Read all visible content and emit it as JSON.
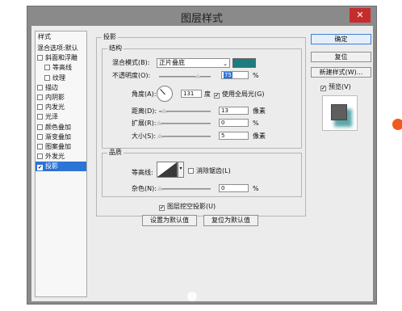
{
  "window": {
    "title": "图层样式",
    "close_glyph": "✕"
  },
  "sidebar": {
    "header": "样式",
    "items": [
      {
        "label": "混合选项:默认",
        "checkbox": false,
        "sub": false
      },
      {
        "label": "斜面和浮雕",
        "checkbox": true,
        "checked": false,
        "sub": false
      },
      {
        "label": "等高线",
        "checkbox": true,
        "checked": false,
        "sub": true
      },
      {
        "label": "纹理",
        "checkbox": true,
        "checked": false,
        "sub": true
      },
      {
        "label": "描边",
        "checkbox": true,
        "checked": false,
        "sub": false
      },
      {
        "label": "内阴影",
        "checkbox": true,
        "checked": false,
        "sub": false
      },
      {
        "label": "内发光",
        "checkbox": true,
        "checked": false,
        "sub": false
      },
      {
        "label": "光泽",
        "checkbox": true,
        "checked": false,
        "sub": false
      },
      {
        "label": "颜色叠加",
        "checkbox": true,
        "checked": false,
        "sub": false
      },
      {
        "label": "渐变叠加",
        "checkbox": true,
        "checked": false,
        "sub": false
      },
      {
        "label": "图案叠加",
        "checkbox": true,
        "checked": false,
        "sub": false
      },
      {
        "label": "外发光",
        "checkbox": true,
        "checked": false,
        "sub": false
      },
      {
        "label": "投影",
        "checkbox": true,
        "checked": true,
        "sub": false,
        "selected": true
      }
    ]
  },
  "drop_shadow": {
    "section_title": "投影",
    "structure": {
      "title": "结构",
      "blend_mode_label": "混合模式(B):",
      "blend_mode_value": "正片叠底",
      "shadow_color": "#1e7c7f",
      "opacity_label": "不透明度(O):",
      "opacity_value": "75",
      "opacity_unit": "%",
      "opacity_fraction": 0.75,
      "angle_label": "角度(A):",
      "angle_value": "131",
      "angle_unit": "度",
      "global_light_label": "使用全局光(G)",
      "global_light_checked": true,
      "distance_label": "距离(D):",
      "distance_value": "13",
      "distance_unit": "像素",
      "spread_label": "扩展(R):",
      "spread_value": "0",
      "spread_unit": "%",
      "size_label": "大小(S):",
      "size_value": "5",
      "size_unit": "像素"
    },
    "quality": {
      "title": "品质",
      "contour_label": "等高线:",
      "anti_alias_label": "消除锯齿(L)",
      "anti_alias_checked": false,
      "noise_label": "杂色(N):",
      "noise_value": "0",
      "noise_unit": "%"
    },
    "knockout_label": "图层挖空投影(U)",
    "knockout_checked": true,
    "make_default_label": "设置为默认值",
    "reset_default_label": "复位为默认值"
  },
  "actions": {
    "ok_label": "确定",
    "reset_label": "复位",
    "new_style_label": "新建样式(W)...",
    "preview_label": "预览(V)",
    "preview_checked": true
  },
  "glyphs": {
    "check": "✔",
    "dropdown_arrow": "⌄",
    "contour_caret": "▾"
  }
}
